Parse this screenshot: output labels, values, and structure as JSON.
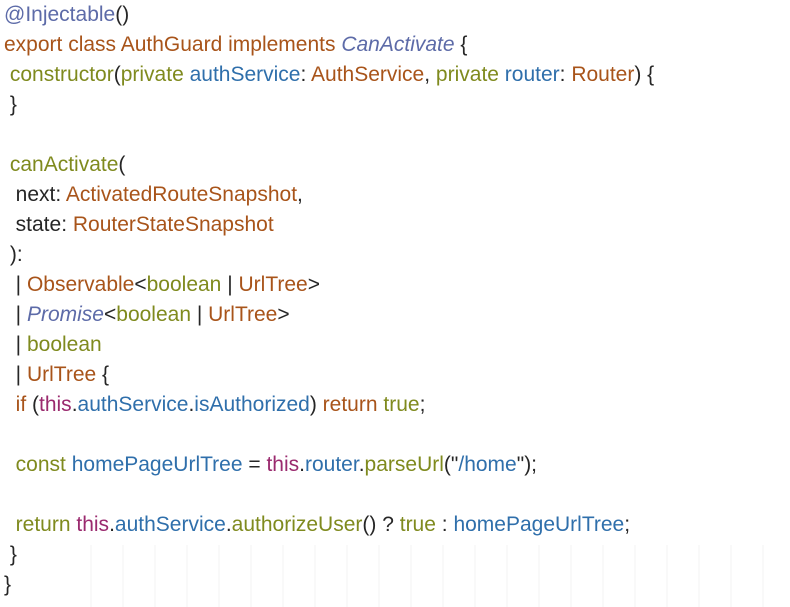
{
  "colors": {
    "decorator": "#5d6ba8",
    "keyword": "#a8541a",
    "type": "#a8541a",
    "interface_italic": "#5d6ba8",
    "identifier": "#2f6fab",
    "function_and_primitive": "#7f8a1e",
    "this_keyword": "#9a2a6e",
    "punctuation": "#262626"
  },
  "code_lines": [
    [
      {
        "t": "@Injectable",
        "k": "dec"
      },
      {
        "t": "()",
        "k": "pun"
      }
    ],
    [
      {
        "t": "export class AuthGuard implements ",
        "k": "kw"
      },
      {
        "t": "CanActivate",
        "k": "iface"
      },
      {
        "t": " {",
        "k": "pun"
      }
    ],
    [
      {
        "t": " ",
        "k": "pun"
      },
      {
        "t": "constructor",
        "k": "fn"
      },
      {
        "t": "(",
        "k": "pun"
      },
      {
        "t": "private ",
        "k": "prim"
      },
      {
        "t": "authService",
        "k": "id"
      },
      {
        "t": ": ",
        "k": "pun"
      },
      {
        "t": "AuthService",
        "k": "cls"
      },
      {
        "t": ", ",
        "k": "pun"
      },
      {
        "t": "private ",
        "k": "prim"
      },
      {
        "t": "router",
        "k": "id"
      },
      {
        "t": ": ",
        "k": "pun"
      },
      {
        "t": "Router",
        "k": "cls"
      },
      {
        "t": ") {",
        "k": "pun"
      }
    ],
    [
      {
        "t": " }",
        "k": "pun"
      }
    ],
    [],
    [
      {
        "t": " ",
        "k": "pun"
      },
      {
        "t": "canActivate",
        "k": "fn"
      },
      {
        "t": "(",
        "k": "pun"
      }
    ],
    [
      {
        "t": "  next: ",
        "k": "pun"
      },
      {
        "t": "ActivatedRouteSnapshot",
        "k": "cls"
      },
      {
        "t": ",",
        "k": "pun"
      }
    ],
    [
      {
        "t": "  state: ",
        "k": "pun"
      },
      {
        "t": "RouterStateSnapshot",
        "k": "cls"
      }
    ],
    [
      {
        "t": " ):",
        "k": "pun"
      }
    ],
    [
      {
        "t": "  | ",
        "k": "pun"
      },
      {
        "t": "Observable",
        "k": "cls"
      },
      {
        "t": "<",
        "k": "pun"
      },
      {
        "t": "boolean",
        "k": "prim"
      },
      {
        "t": " | ",
        "k": "pun"
      },
      {
        "t": "UrlTree",
        "k": "cls"
      },
      {
        "t": ">",
        "k": "pun"
      }
    ],
    [
      {
        "t": "  | ",
        "k": "pun"
      },
      {
        "t": "Promise",
        "k": "iface"
      },
      {
        "t": "<",
        "k": "pun"
      },
      {
        "t": "boolean",
        "k": "prim"
      },
      {
        "t": " | ",
        "k": "pun"
      },
      {
        "t": "UrlTree",
        "k": "cls"
      },
      {
        "t": ">",
        "k": "pun"
      }
    ],
    [
      {
        "t": "  | ",
        "k": "pun"
      },
      {
        "t": "boolean",
        "k": "prim"
      }
    ],
    [
      {
        "t": "  | ",
        "k": "pun"
      },
      {
        "t": "UrlTree",
        "k": "cls"
      },
      {
        "t": " {",
        "k": "pun"
      }
    ],
    [
      {
        "t": "  ",
        "k": "pun"
      },
      {
        "t": "if",
        "k": "kw"
      },
      {
        "t": " (",
        "k": "pun"
      },
      {
        "t": "this",
        "k": "this"
      },
      {
        "t": ".",
        "k": "pun"
      },
      {
        "t": "authService",
        "k": "id"
      },
      {
        "t": ".",
        "k": "pun"
      },
      {
        "t": "isAuthorized",
        "k": "id"
      },
      {
        "t": ") ",
        "k": "pun"
      },
      {
        "t": "return",
        "k": "kw"
      },
      {
        "t": " ",
        "k": "pun"
      },
      {
        "t": "true",
        "k": "prim"
      },
      {
        "t": ";",
        "k": "pun"
      }
    ],
    [],
    [
      {
        "t": "  ",
        "k": "pun"
      },
      {
        "t": "const",
        "k": "prim"
      },
      {
        "t": " ",
        "k": "pun"
      },
      {
        "t": "homePageUrlTree",
        "k": "id"
      },
      {
        "t": " = ",
        "k": "pun"
      },
      {
        "t": "this",
        "k": "this"
      },
      {
        "t": ".",
        "k": "pun"
      },
      {
        "t": "router",
        "k": "id"
      },
      {
        "t": ".",
        "k": "pun"
      },
      {
        "t": "parseUrl",
        "k": "fn"
      },
      {
        "t": "(\"",
        "k": "pun"
      },
      {
        "t": "/home",
        "k": "str"
      },
      {
        "t": "\");",
        "k": "pun"
      }
    ],
    [],
    [
      {
        "t": "  ",
        "k": "pun"
      },
      {
        "t": "return",
        "k": "prim"
      },
      {
        "t": " ",
        "k": "pun"
      },
      {
        "t": "this",
        "k": "this"
      },
      {
        "t": ".",
        "k": "pun"
      },
      {
        "t": "authService",
        "k": "id"
      },
      {
        "t": ".",
        "k": "pun"
      },
      {
        "t": "authorizeUser",
        "k": "fn"
      },
      {
        "t": "() ? ",
        "k": "pun"
      },
      {
        "t": "true",
        "k": "prim"
      },
      {
        "t": " : ",
        "k": "pun"
      },
      {
        "t": "homePageUrlTree",
        "k": "id"
      },
      {
        "t": ";",
        "k": "pun"
      }
    ],
    [
      {
        "t": " }",
        "k": "pun"
      }
    ],
    [
      {
        "t": "}",
        "k": "pun"
      }
    ]
  ]
}
